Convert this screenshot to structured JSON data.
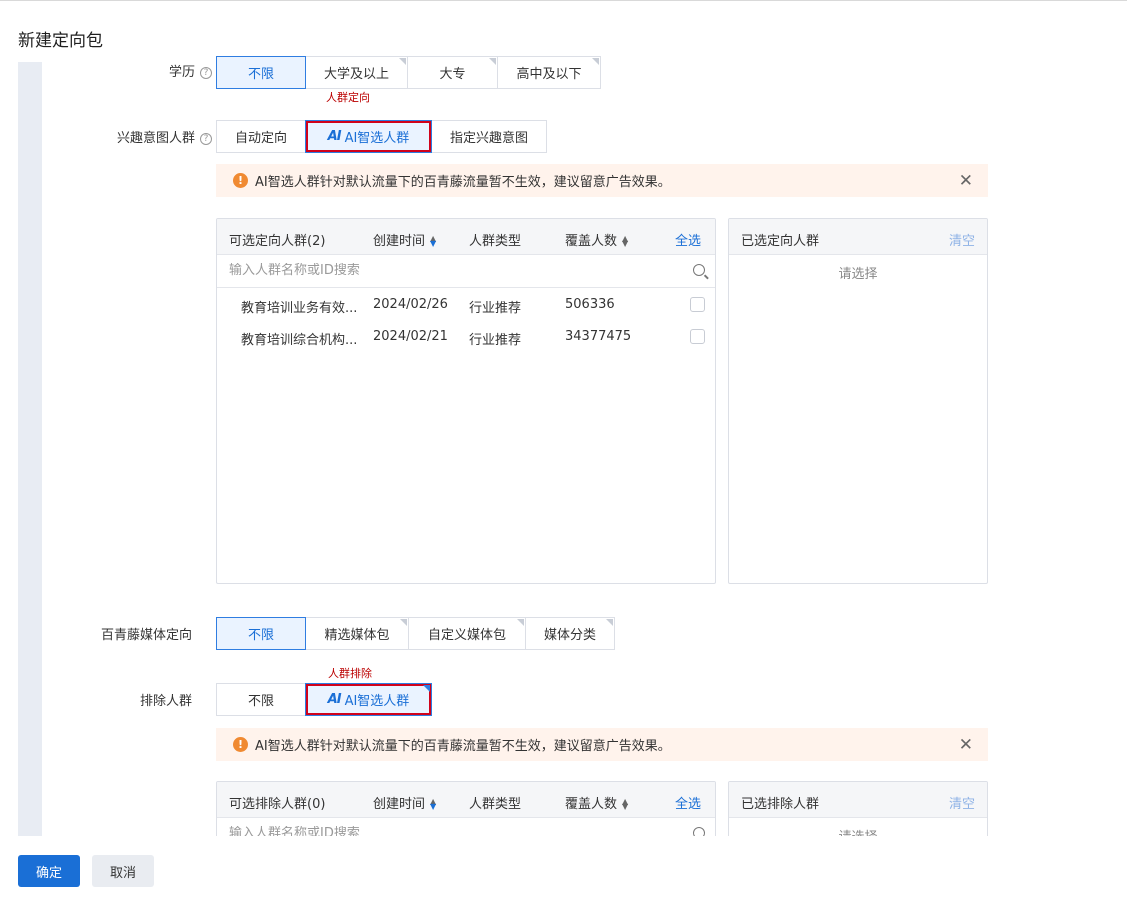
{
  "dialog": {
    "title": "新建定向包"
  },
  "education": {
    "label": "学历",
    "options": [
      "不限",
      "大学及以上",
      "大专",
      "高中及以下"
    ]
  },
  "interest": {
    "label": "兴趣意图人群",
    "red_note": "人群定向",
    "options": [
      "自动定向",
      "AI智选人群",
      "指定兴趣意图"
    ],
    "ai_mark": "AI",
    "alert_text": "AI智选人群针对默认流量下的百青藤流量暂不生效，建议留意广告效果。",
    "available": {
      "title": "可选定向人群(2)",
      "col_created": "创建时间",
      "col_type": "人群类型",
      "col_cover": "覆盖人数",
      "select_all": "全选",
      "search_placeholder": "输入人群名称或ID搜索",
      "rows": [
        {
          "name": "教育培训业务有效...",
          "date": "2024/02/26",
          "type": "行业推荐",
          "cover": "506336"
        },
        {
          "name": "教育培训综合机构...",
          "date": "2024/02/21",
          "type": "行业推荐",
          "cover": "34377475"
        }
      ]
    },
    "selected": {
      "title": "已选定向人群",
      "clear": "清空",
      "placeholder": "请选择"
    }
  },
  "media": {
    "label": "百青藤媒体定向",
    "options": [
      "不限",
      "精选媒体包",
      "自定义媒体包",
      "媒体分类"
    ]
  },
  "exclude": {
    "label": "排除人群",
    "red_note": "人群排除",
    "options": [
      "不限",
      "AI智选人群"
    ],
    "ai_mark": "AI",
    "alert_text": "AI智选人群针对默认流量下的百青藤流量暂不生效，建议留意广告效果。",
    "available": {
      "title": "可选排除人群(0)",
      "col_created": "创建时间",
      "col_type": "人群类型",
      "col_cover": "覆盖人数",
      "select_all": "全选",
      "search_placeholder": "输入人群名称或ID搜索"
    },
    "selected": {
      "title": "已选排除人群",
      "clear": "清空",
      "placeholder": "请选择"
    }
  },
  "footer": {
    "confirm": "确定",
    "cancel": "取消"
  },
  "colors": {
    "accent": "#1a6fd6",
    "alert_bg": "#fff3ec",
    "warn": "#f08a32",
    "highlight_box": "#d0021b"
  }
}
